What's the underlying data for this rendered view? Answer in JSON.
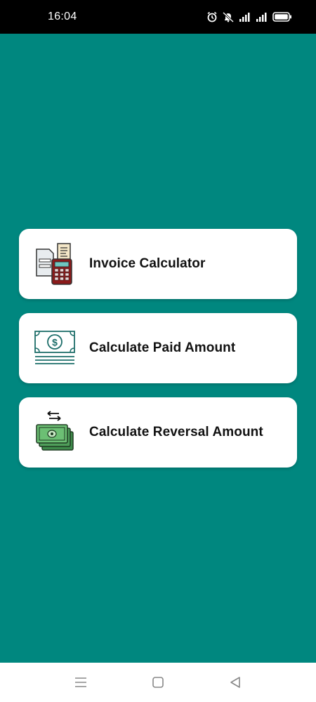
{
  "status_bar": {
    "time": "16:04",
    "icons": [
      "alarm-icon",
      "mute-icon",
      "signal-icon",
      "signal-icon",
      "battery-icon"
    ]
  },
  "menu": {
    "items": [
      {
        "label": "Invoice Calculator",
        "icon": "invoice-calculator-icon"
      },
      {
        "label": "Calculate Paid Amount",
        "icon": "banknote-icon"
      },
      {
        "label": "Calculate Reversal Amount",
        "icon": "money-exchange-icon"
      }
    ]
  },
  "nav_bar": {
    "buttons": [
      "menu-icon",
      "home-square-icon",
      "back-triangle-icon"
    ]
  },
  "colors": {
    "background": "#00877f",
    "card": "#ffffff",
    "text": "#111111"
  }
}
